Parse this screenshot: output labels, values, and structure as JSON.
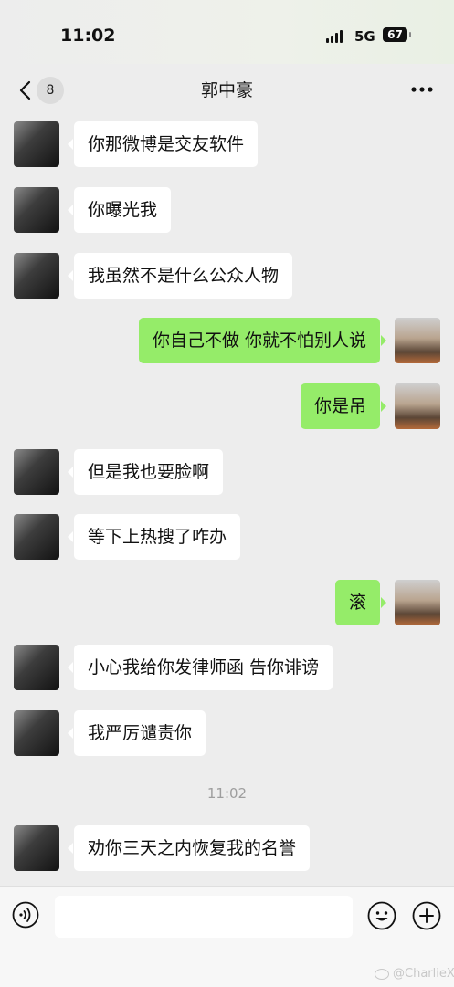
{
  "status": {
    "time": "11:02",
    "network": "5G",
    "battery": "67"
  },
  "header": {
    "unread_count": "8",
    "title": "郭中豪"
  },
  "messages": [
    {
      "side": "in",
      "text": "你那微博是交友软件"
    },
    {
      "side": "in",
      "text": "你曝光我"
    },
    {
      "side": "in",
      "text": "我虽然不是什么公众人物"
    },
    {
      "side": "out",
      "text": "你自己不做 你就不怕别人说"
    },
    {
      "side": "out",
      "text": "你是吊"
    },
    {
      "side": "in",
      "text": "但是我也要脸啊"
    },
    {
      "side": "in",
      "text": "等下上热搜了咋办"
    },
    {
      "side": "out",
      "text": "滚"
    },
    {
      "side": "in",
      "text": "小心我给你发律师函 告你诽谤"
    },
    {
      "side": "in",
      "text": "我严厉谴责你"
    },
    {
      "side": "in",
      "text": "劝你三天之内恢复我的名誉"
    }
  ],
  "timestamp": "11:02",
  "watermark": "@CharlieXW",
  "icons": [
    "back-chevron-icon",
    "more-icon",
    "voice-icon",
    "emoji-icon",
    "plus-icon",
    "weibo-logo-icon"
  ]
}
